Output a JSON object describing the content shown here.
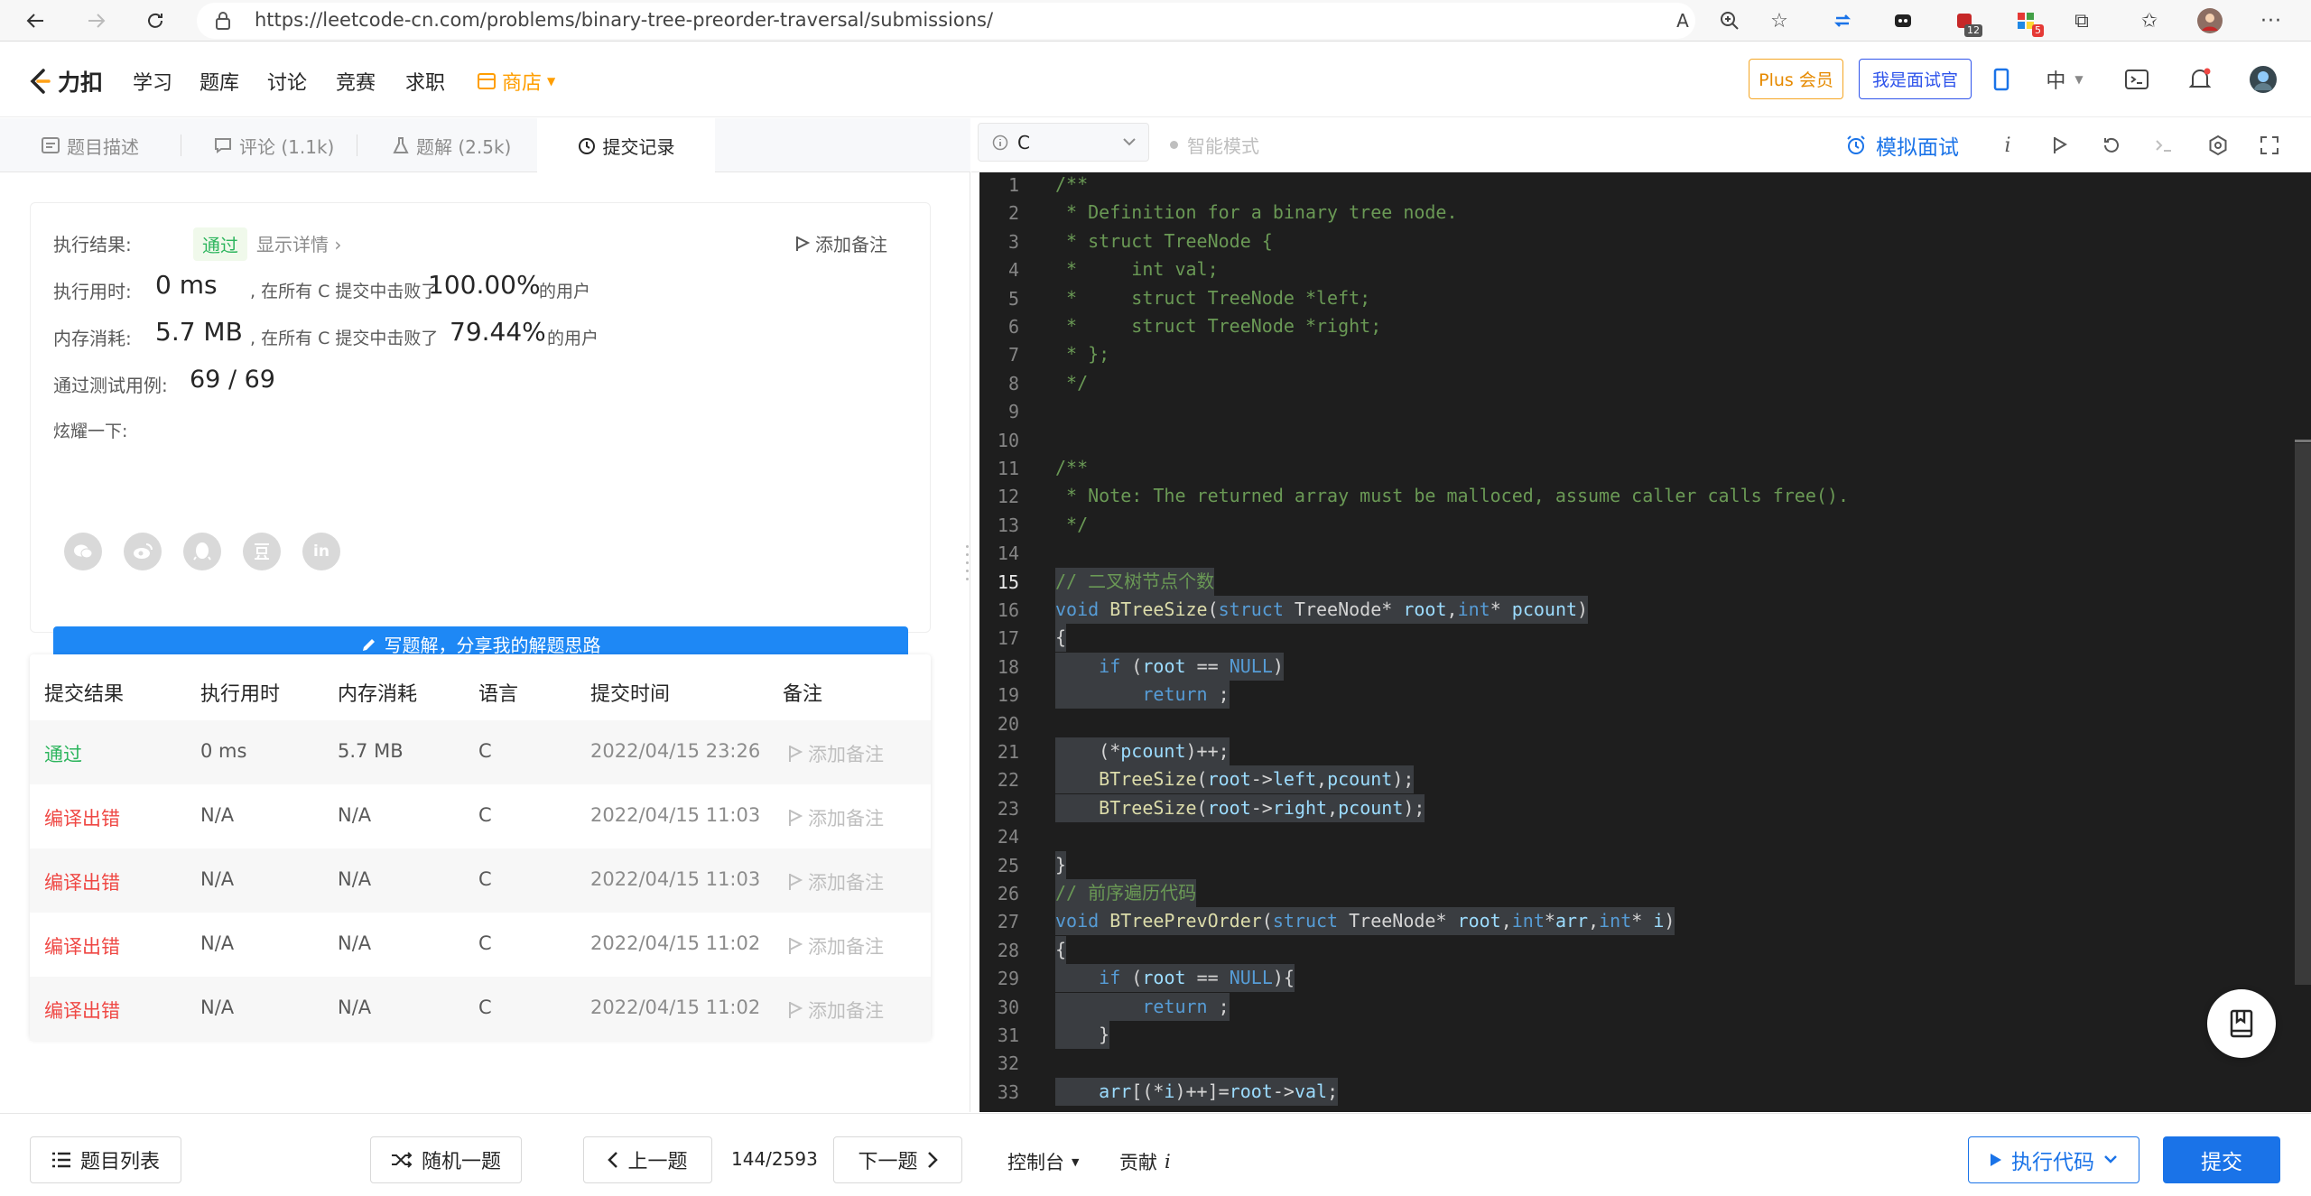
{
  "browser": {
    "url": "https://leetcode-cn.com/problems/binary-tree-preorder-traversal/submissions/",
    "ext_badge_1": "12",
    "ext_badge_2": "5"
  },
  "header": {
    "logo": "力扣",
    "nav": [
      "学习",
      "题库",
      "讨论",
      "竞赛",
      "求职",
      "商店"
    ],
    "plus_label": "Plus 会员",
    "interviewer_label": "我是面试官",
    "lang_label": "中"
  },
  "tabs": [
    {
      "label": "题目描述"
    },
    {
      "label": "评论 (1.1k)"
    },
    {
      "label": "题解 (2.5k)"
    },
    {
      "label": "提交记录"
    }
  ],
  "result": {
    "result_label": "执行结果:",
    "result_value": "通过",
    "detail_link": "显示详情 ›",
    "add_note": "添加备注",
    "time_label": "执行用时:",
    "time_value": "0 ms",
    "time_mid": ", 在所有 C 提交中击败了",
    "time_pct": "100.00%",
    "time_tail": "的用户",
    "mem_label": "内存消耗:",
    "mem_value": "5.7 MB",
    "mem_mid": ", 在所有 C 提交中击败了",
    "mem_pct": "79.44%",
    "mem_tail": "的用户",
    "cases_label": "通过测试用例:",
    "cases_value": "69 / 69",
    "share_label": "炫耀一下:",
    "share_icons": [
      "wechat-icon",
      "weibo-icon",
      "qq-icon",
      "douban-icon",
      "linkedin-icon"
    ],
    "write_btn": "写题解，分享我的解题思路"
  },
  "submissions": {
    "headers": [
      "提交结果",
      "执行用时",
      "内存消耗",
      "语言",
      "提交时间",
      "备注"
    ],
    "rows": [
      {
        "status": "通过",
        "time": "0 ms",
        "memory": "5.7 MB",
        "lang": "C",
        "submitted": "2022/04/15 23:26",
        "note": "添加备注"
      },
      {
        "status": "编译出错",
        "time": "N/A",
        "memory": "N/A",
        "lang": "C",
        "submitted": "2022/04/15 11:03",
        "note": "添加备注"
      },
      {
        "status": "编译出错",
        "time": "N/A",
        "memory": "N/A",
        "lang": "C",
        "submitted": "2022/04/15 11:03",
        "note": "添加备注"
      },
      {
        "status": "编译出错",
        "time": "N/A",
        "memory": "N/A",
        "lang": "C",
        "submitted": "2022/04/15 11:02",
        "note": "添加备注"
      },
      {
        "status": "编译出错",
        "time": "N/A",
        "memory": "N/A",
        "lang": "C",
        "submitted": "2022/04/15 11:02",
        "note": "添加备注"
      }
    ]
  },
  "editor_toolbar": {
    "language": "C",
    "smart_mode": "智能模式",
    "mock_interview": "模拟面试"
  },
  "code": {
    "current_line": "15",
    "line_numbers": [
      "1",
      "2",
      "3",
      "4",
      "5",
      "6",
      "7",
      "8",
      "9",
      "10",
      "11",
      "12",
      "13",
      "14",
      "15",
      "16",
      "17",
      "18",
      "19",
      "20",
      "21",
      "22",
      "23",
      "24",
      "25",
      "26",
      "27",
      "28",
      "29",
      "30",
      "31",
      "32",
      "33"
    ],
    "lines": [
      "/**",
      " * Definition for a binary tree node.",
      " * struct TreeNode {",
      " *     int val;",
      " *     struct TreeNode *left;",
      " *     struct TreeNode *right;",
      " * };",
      " */",
      "",
      "",
      "/**",
      " * Note: The returned array must be malloced, assume caller calls free().",
      " */",
      "",
      "// 二叉树节点个数",
      "void BTreeSize(struct TreeNode* root,int* pcount)",
      "{",
      "    if (root == NULL)",
      "        return ;",
      "",
      "    (*pcount)++;",
      "    BTreeSize(root->left,pcount);",
      "    BTreeSize(root->right,pcount);",
      "",
      "}",
      "// 前序遍历代码",
      "void BTreePrevOrder(struct TreeNode* root,int*arr,int* i)",
      "{",
      "    if (root == NULL){",
      "        return ;",
      "    }",
      "",
      "    arr[(*i)++]=root->val;"
    ]
  },
  "bottom": {
    "problem_list": "题目列表",
    "random": "随机一题",
    "prev": "上一题",
    "page": "144/2593",
    "next": "下一题",
    "console": "控制台",
    "contribute": "贡献",
    "run": "执行代码",
    "submit": "提交"
  },
  "colors": {
    "accent": "#1a73e8",
    "success": "#2db55d",
    "error": "#ef4743",
    "plus": "#e68a00"
  }
}
